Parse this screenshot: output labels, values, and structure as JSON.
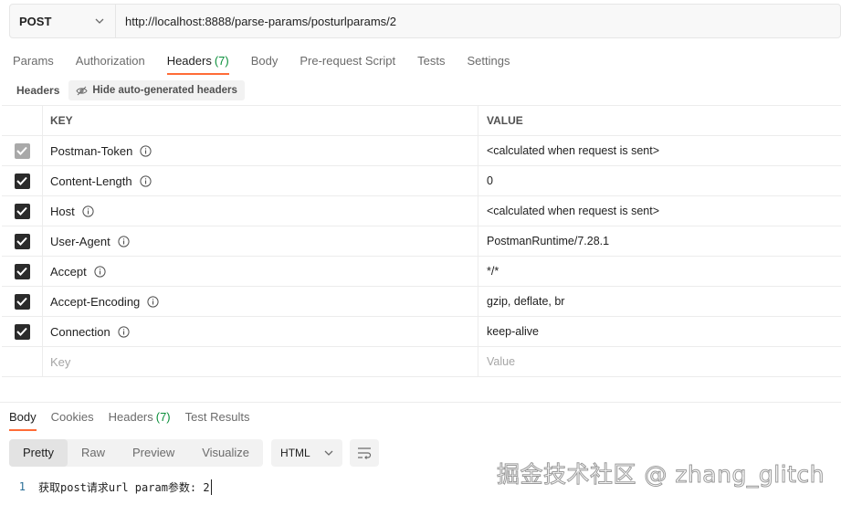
{
  "request": {
    "method": "POST",
    "url": "http://localhost:8888/parse-params/posturlparams/2"
  },
  "request_tabs": [
    {
      "label": "Params",
      "count": ""
    },
    {
      "label": "Authorization",
      "count": ""
    },
    {
      "label": "Headers",
      "count": "(7)"
    },
    {
      "label": "Body",
      "count": ""
    },
    {
      "label": "Pre-request Script",
      "count": ""
    },
    {
      "label": "Tests",
      "count": ""
    },
    {
      "label": "Settings",
      "count": ""
    }
  ],
  "active_request_tab": "Headers",
  "headers_section": {
    "title": "Headers",
    "hide_button": "Hide auto-generated headers"
  },
  "table": {
    "columns": {
      "key": "KEY",
      "value": "VALUE"
    },
    "rows": [
      {
        "key": "Postman-Token",
        "value": "<calculated when request is sent>",
        "checked": true,
        "disabled": true
      },
      {
        "key": "Content-Length",
        "value": "0",
        "checked": true,
        "disabled": false
      },
      {
        "key": "Host",
        "value": "<calculated when request is sent>",
        "checked": true,
        "disabled": false
      },
      {
        "key": "User-Agent",
        "value": "PostmanRuntime/7.28.1",
        "checked": true,
        "disabled": false
      },
      {
        "key": "Accept",
        "value": "*/*",
        "checked": true,
        "disabled": false
      },
      {
        "key": "Accept-Encoding",
        "value": "gzip, deflate, br",
        "checked": true,
        "disabled": false
      },
      {
        "key": "Connection",
        "value": "keep-alive",
        "checked": true,
        "disabled": false
      }
    ],
    "new_row": {
      "key_placeholder": "Key",
      "value_placeholder": "Value"
    }
  },
  "response_tabs": [
    {
      "label": "Body",
      "count": ""
    },
    {
      "label": "Cookies",
      "count": ""
    },
    {
      "label": "Headers",
      "count": "(7)"
    },
    {
      "label": "Test Results",
      "count": ""
    }
  ],
  "active_response_tab": "Body",
  "view_modes": [
    "Pretty",
    "Raw",
    "Preview",
    "Visualize"
  ],
  "active_view_mode": "Pretty",
  "format": "HTML",
  "response_body": {
    "line_number": "1",
    "text": "获取post请求url param参数: 2"
  },
  "watermark": "掘金技术社区 @ zhang_glitch",
  "colors": {
    "accent": "#ff6c37",
    "count_green": "#0a8f3a"
  }
}
